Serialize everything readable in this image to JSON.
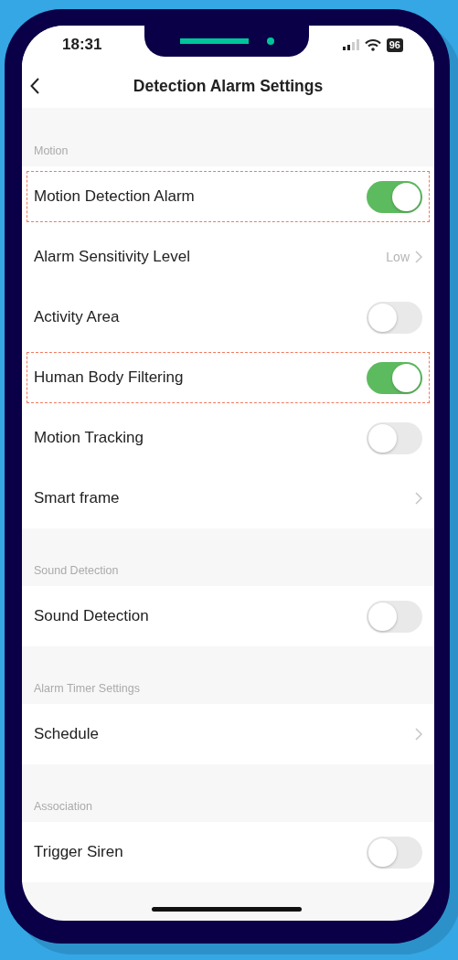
{
  "status_bar": {
    "time": "18:31",
    "battery": "96"
  },
  "header": {
    "title": "Detection Alarm Settings"
  },
  "sections": [
    {
      "label": "Motion",
      "rows": [
        {
          "kind": "toggle",
          "label": "Motion Detection Alarm",
          "on": true,
          "highlighted": true
        },
        {
          "kind": "link",
          "label": "Alarm Sensitivity Level",
          "value": "Low",
          "highlighted": false
        },
        {
          "kind": "toggle",
          "label": "Activity Area",
          "on": false,
          "highlighted": false
        },
        {
          "kind": "toggle",
          "label": "Human Body Filtering",
          "on": true,
          "highlighted": true
        },
        {
          "kind": "toggle",
          "label": "Motion Tracking",
          "on": false,
          "highlighted": false
        },
        {
          "kind": "link",
          "label": "Smart frame",
          "highlighted": false
        }
      ]
    },
    {
      "label": "Sound Detection",
      "rows": [
        {
          "kind": "toggle",
          "label": "Sound Detection",
          "on": false,
          "highlighted": false
        }
      ]
    },
    {
      "label": "Alarm Timer Settings",
      "rows": [
        {
          "kind": "link",
          "label": "Schedule",
          "highlighted": false
        }
      ]
    },
    {
      "label": "Association",
      "rows": [
        {
          "kind": "toggle",
          "label": "Trigger Siren",
          "on": false,
          "highlighted": false
        }
      ]
    }
  ]
}
